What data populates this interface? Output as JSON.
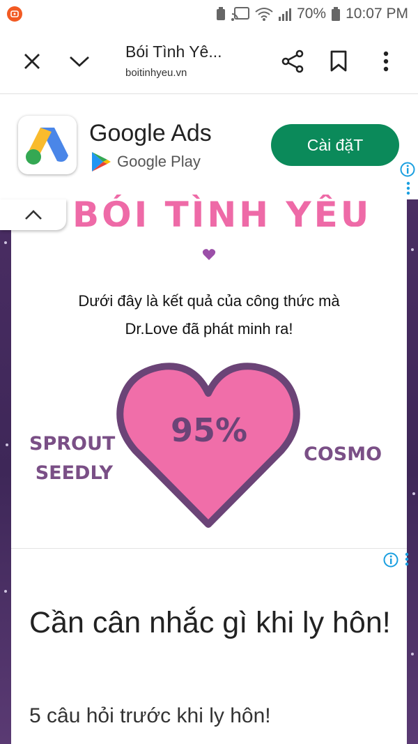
{
  "status_bar": {
    "battery": "70%",
    "time": "10:07 PM"
  },
  "toolbar": {
    "title": "Bói Tình Yê...",
    "url": "boitinhyeu.vn",
    "icons": [
      "close-icon",
      "chevron-down-icon",
      "share-icon",
      "bookmark-icon",
      "more-vert-icon"
    ]
  },
  "ad_banner": {
    "app_name": "Google Ads",
    "store_label": "Google Play",
    "install_label": "Cài đặT",
    "install_color": "#0b8a5a"
  },
  "page": {
    "heading": "BÓI TÌNH YÊU",
    "intro_line1": "Dưới đây là kết quả của công thức mà",
    "intro_line2": "Dr.Love đã phát minh ra!",
    "score": "95%",
    "name_left_line1": "SPROUT",
    "name_left_line2": "SEEDLY",
    "name_right": "COSMO",
    "heading_color": "#ee6aa7",
    "heart_fill": "#f06ea9",
    "heart_stroke": "#6b4477"
  },
  "second_ad": {
    "title": "Cần cân nhắc gì khi ly hôn!",
    "subtitle": "5 câu hỏi trước khi ly hôn!"
  }
}
